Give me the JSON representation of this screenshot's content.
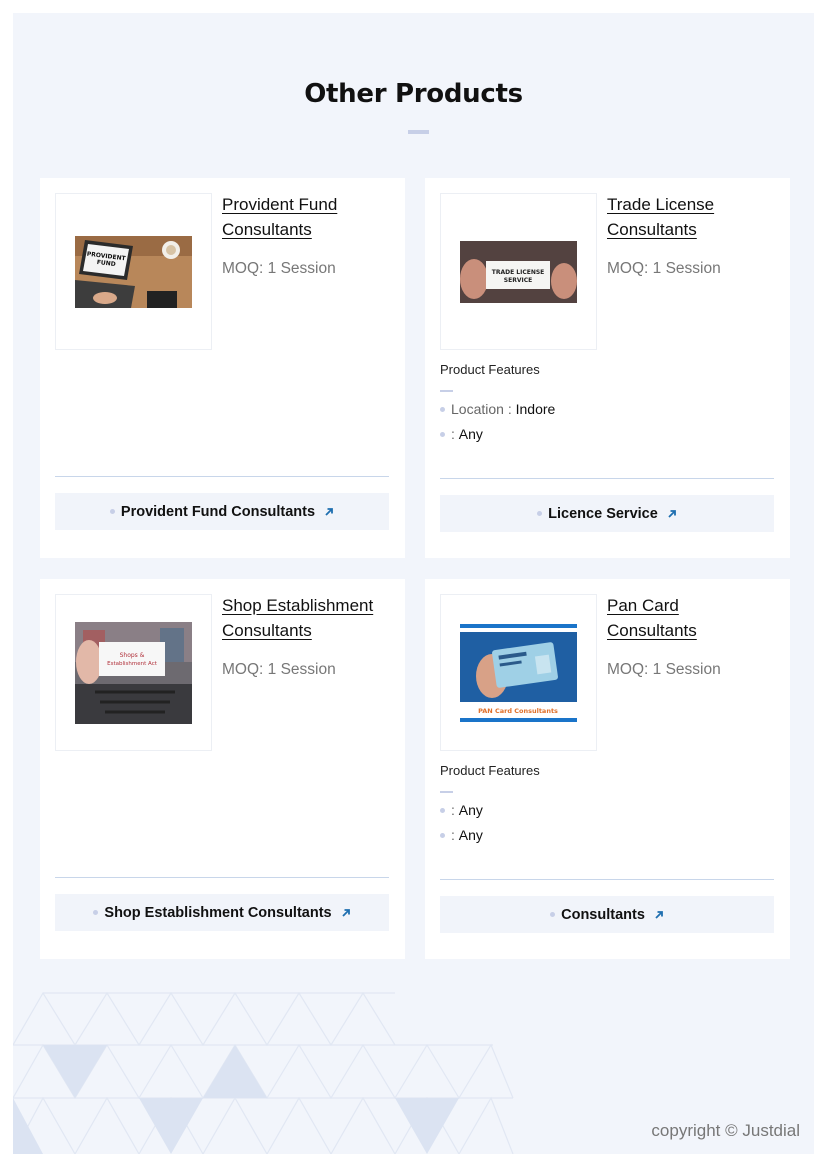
{
  "section": {
    "title": "Other Products"
  },
  "colors": {
    "accent_arrow": "#1f6fb0",
    "dash": "#c7cfe7",
    "page_bg": "#f2f5fb"
  },
  "products": [
    {
      "name_line1": "Provident Fund",
      "name_line2": "Consultants",
      "moq": "MOQ: 1 Session",
      "image_text_1": "PROVIDENT",
      "image_text_2": "FUND",
      "cta": "Provident Fund Consultants",
      "cta_icon": "arrow-up-right-icon"
    },
    {
      "name_line1": "Trade License",
      "name_line2": "Consultants",
      "moq": "MOQ: 1 Session",
      "image_text_1": "TRADE LICENSE",
      "image_text_2": "SERVICE",
      "features_title": "Product Features",
      "features": [
        {
          "key": "Location",
          "value": "Indore"
        },
        {
          "key": "",
          "value": "Any"
        }
      ],
      "cta": "Licence Service",
      "cta_icon": "arrow-up-right-icon"
    },
    {
      "name_line1": "Shop Establishment",
      "name_line2": "Consultants",
      "moq": "MOQ: 1 Session",
      "image_text_1": "Shops &",
      "image_text_2": "Establishment Act",
      "cta": "Shop Establishment Consultants",
      "cta_icon": "arrow-up-right-icon"
    },
    {
      "name_line1": "Pan Card",
      "name_line2": "Consultants",
      "moq": "MOQ: 1 Session",
      "image_text_1": "PAN Card Consultants",
      "features_title": "Product Features",
      "features": [
        {
          "key": "",
          "value": "Any"
        },
        {
          "key": "",
          "value": "Any"
        }
      ],
      "cta": "Consultants",
      "cta_icon": "arrow-up-right-icon"
    }
  ],
  "footer": {
    "copyright": "copyright © Justdial"
  }
}
